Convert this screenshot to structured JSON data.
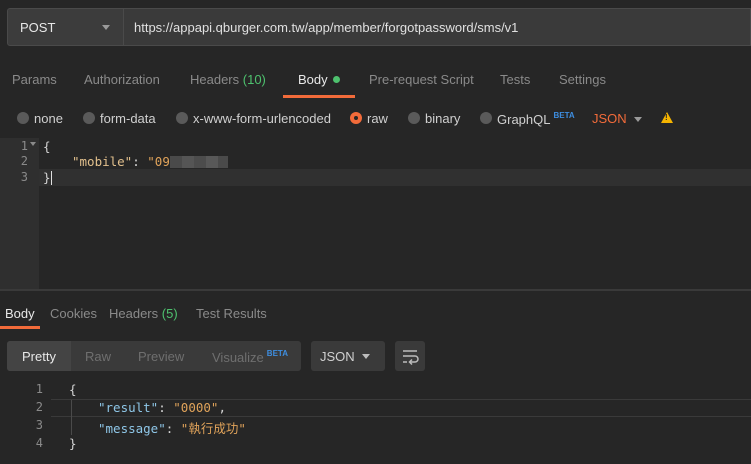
{
  "request": {
    "method": "POST",
    "url": "https://appapi.qburger.com.tw/app/member/forgotpassword/sms/v1"
  },
  "request_tabs": [
    {
      "label": "Params",
      "count": ""
    },
    {
      "label": "Authorization",
      "count": ""
    },
    {
      "label": "Headers",
      "count": "(10)"
    },
    {
      "label": "Body",
      "count": "",
      "active": true
    },
    {
      "label": "Pre-request Script",
      "count": ""
    },
    {
      "label": "Tests",
      "count": ""
    },
    {
      "label": "Settings",
      "count": ""
    }
  ],
  "body_types": {
    "none": "none",
    "form_data": "form-data",
    "urlencoded": "x-www-form-urlencoded",
    "raw": "raw",
    "binary": "binary",
    "graphql": "GraphQL",
    "beta": "BETA",
    "selected": "raw",
    "format": "JSON"
  },
  "request_body": {
    "line_numbers": [
      "1",
      "2",
      "3"
    ],
    "line1": "{",
    "key": "\"mobile\"",
    "colon": ": ",
    "value_visible": "\"09",
    "line3": "}"
  },
  "response_tabs": [
    {
      "label": "Body",
      "count": "",
      "active": true
    },
    {
      "label": "Cookies",
      "count": ""
    },
    {
      "label": "Headers",
      "count": "(5)"
    },
    {
      "label": "Test Results",
      "count": ""
    }
  ],
  "response_view": {
    "pretty": "Pretty",
    "raw": "Raw",
    "preview": "Preview",
    "visualize": "Visualize",
    "beta": "BETA",
    "format": "JSON"
  },
  "response_body": {
    "line_numbers": [
      "1",
      "2",
      "3",
      "4"
    ],
    "open": "{",
    "result_key": "\"result\"",
    "result_value": "\"0000\"",
    "message_key": "\"message\"",
    "message_value": "\"執行成功\"",
    "close": "}"
  },
  "colors": {
    "accent": "#f26b3a",
    "count_green": "#4ec16e",
    "beta_blue": "#3e8ee0",
    "warning": "#f5b400"
  },
  "icons": [
    "chevron-down-icon",
    "warning-icon",
    "wrap-lines-icon"
  ]
}
